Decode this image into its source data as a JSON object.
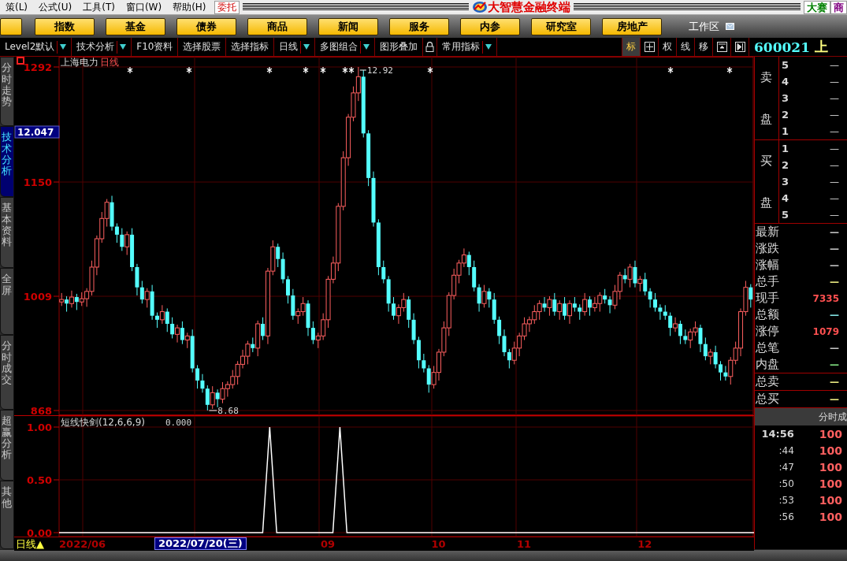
{
  "menu": {
    "items": [
      "策(L)",
      "公式(U)",
      "工具(T)",
      "窗口(W)",
      "帮助(H)"
    ],
    "trade_button": "委托",
    "app_title": "大智慧金融终端",
    "right_buttons": [
      {
        "label": "大赛",
        "color": "#008000"
      },
      {
        "label": "商",
        "color": "#800080"
      }
    ]
  },
  "nav": {
    "buttons": [
      "指数",
      "基金",
      "债券",
      "商品",
      "新闻",
      "服务",
      "内参",
      "研究室",
      "房地产"
    ],
    "workspace": "工作区"
  },
  "toolbar": {
    "items": [
      {
        "kind": "text",
        "label": "Level2默认",
        "dropdown": true
      },
      {
        "kind": "text",
        "label": "技术分析",
        "dropdown": true
      },
      {
        "kind": "text",
        "label": "F10资料",
        "dropdown": false
      },
      {
        "kind": "text",
        "label": "选择股票",
        "dropdown": false
      },
      {
        "kind": "text",
        "label": "选择指标",
        "dropdown": false
      },
      {
        "kind": "text",
        "label": "日线",
        "dropdown": true
      },
      {
        "kind": "text",
        "label": "多图组合",
        "dropdown": true
      },
      {
        "kind": "text",
        "label": "图形叠加",
        "dropdown": false
      },
      {
        "kind": "lock"
      },
      {
        "kind": "text",
        "label": "常用指标",
        "dropdown": true
      }
    ],
    "tools": [
      {
        "kind": "text",
        "label": "标",
        "selected": true
      },
      {
        "kind": "grid",
        "selected": false
      },
      {
        "kind": "text",
        "label": "权",
        "selected": false
      },
      {
        "kind": "text",
        "label": "线",
        "selected": false
      },
      {
        "kind": "text",
        "label": "移",
        "selected": false
      },
      {
        "kind": "window",
        "selected": false
      },
      {
        "kind": "next",
        "selected": false
      }
    ]
  },
  "stock": {
    "code": "600021",
    "name": "上"
  },
  "side_tabs": [
    {
      "label": "分时走势",
      "selected": false
    },
    {
      "label": "技术分析",
      "selected": true
    },
    {
      "label": "基本资料",
      "selected": false
    },
    {
      "label": "全屏",
      "selected": false
    },
    {
      "label": "分时成交",
      "selected": false
    },
    {
      "label": "超赢分析",
      "selected": false
    },
    {
      "label": "其他",
      "selected": false
    }
  ],
  "chart": {
    "title": "上海电力",
    "period": "日线",
    "cursor_value": "12.047",
    "high_label": "12.92",
    "low_label": "8.68",
    "chart_data": {
      "type": "candlestick",
      "grid": true,
      "ylim": [
        868,
        1292
      ],
      "yticks": [
        {
          "value": 1292,
          "label": "1292"
        },
        {
          "value": 1150,
          "label": "1150"
        },
        {
          "value": 1009,
          "label": "1009"
        },
        {
          "value": 868,
          "label": "868"
        }
      ],
      "categories": [
        null,
        null,
        null,
        null,
        null,
        null,
        null,
        null,
        null,
        null,
        null,
        null,
        null,
        null,
        null,
        null,
        null,
        null,
        null,
        null,
        null,
        null,
        null,
        null,
        null,
        null,
        null,
        null,
        null,
        null,
        null,
        null,
        null,
        null,
        null,
        null,
        null,
        null,
        null,
        null,
        null,
        null,
        null,
        null,
        null,
        null,
        null,
        null,
        null,
        null,
        null,
        null,
        null,
        null,
        null,
        null,
        null,
        null,
        null,
        null,
        null,
        null,
        null,
        null,
        null,
        null,
        null,
        null,
        null,
        null,
        null,
        null,
        null,
        null,
        null,
        null,
        null,
        null,
        null,
        null,
        null,
        null,
        null,
        null,
        null,
        null,
        null,
        null,
        null,
        null,
        null,
        null,
        null,
        null,
        null,
        null,
        null,
        null,
        null,
        null,
        null,
        null,
        null,
        null,
        null,
        null,
        null,
        null,
        null,
        null,
        null,
        null,
        null,
        null,
        null,
        null,
        null,
        null,
        null,
        null,
        null,
        null,
        null,
        null,
        null,
        null,
        null,
        null,
        null,
        null,
        null,
        null,
        null,
        null,
        null,
        null,
        null,
        null
      ],
      "ohlc": [
        [
          1002,
          1013,
          997,
          1005
        ],
        [
          1005,
          1009,
          990,
          1000
        ],
        [
          1000,
          1016,
          995,
          1008
        ],
        [
          1008,
          1012,
          992,
          1002
        ],
        [
          1002,
          1014,
          997,
          1006
        ],
        [
          1006,
          1019,
          996,
          1015
        ],
        [
          1015,
          1053,
          1010,
          1045
        ],
        [
          1045,
          1084,
          1035,
          1080
        ],
        [
          1080,
          1113,
          1075,
          1105
        ],
        [
          1105,
          1129,
          1095,
          1125
        ],
        [
          1125,
          1133,
          1090,
          1095
        ],
        [
          1095,
          1099,
          1075,
          1085
        ],
        [
          1085,
          1093,
          1065,
          1070
        ],
        [
          1070,
          1089,
          1060,
          1085
        ],
        [
          1085,
          1093,
          1040,
          1045
        ],
        [
          1045,
          1049,
          1010,
          1020
        ],
        [
          1020,
          1028,
          1000,
          1005
        ],
        [
          1005,
          1019,
          995,
          1015
        ],
        [
          1015,
          1023,
          980,
          985
        ],
        [
          985,
          989,
          970,
          980
        ],
        [
          980,
          998,
          975,
          990
        ],
        [
          990,
          994,
          965,
          975
        ],
        [
          975,
          983,
          957,
          962
        ],
        [
          962,
          974,
          952,
          970
        ],
        [
          970,
          978,
          950,
          955
        ],
        [
          955,
          964,
          945,
          960
        ],
        [
          960,
          968,
          915,
          920
        ],
        [
          920,
          924,
          895,
          905
        ],
        [
          905,
          913,
          890,
          895
        ],
        [
          895,
          899,
          868,
          875
        ],
        [
          875,
          898,
          870,
          890
        ],
        [
          890,
          894,
          872,
          882
        ],
        [
          882,
          903,
          877,
          895
        ],
        [
          895,
          904,
          885,
          900
        ],
        [
          900,
          918,
          895,
          910
        ],
        [
          910,
          929,
          900,
          925
        ],
        [
          925,
          943,
          920,
          935
        ],
        [
          935,
          954,
          925,
          950
        ],
        [
          950,
          958,
          940,
          945
        ],
        [
          945,
          979,
          935,
          975
        ],
        [
          975,
          983,
          955,
          960
        ],
        [
          960,
          1044,
          950,
          1040
        ],
        [
          1040,
          1078,
          1035,
          1070
        ],
        [
          1070,
          1074,
          1045,
          1055
        ],
        [
          1055,
          1063,
          1025,
          1030
        ],
        [
          1030,
          1034,
          1000,
          1010
        ],
        [
          1010,
          1018,
          980,
          985
        ],
        [
          985,
          994,
          975,
          990
        ],
        [
          990,
          1008,
          985,
          1000
        ],
        [
          1000,
          1004,
          960,
          970
        ],
        [
          970,
          978,
          950,
          955
        ],
        [
          955,
          964,
          945,
          960
        ],
        [
          960,
          988,
          955,
          980
        ],
        [
          980,
          1034,
          970,
          1030
        ],
        [
          1030,
          1058,
          1025,
          1050
        ],
        [
          1050,
          1124,
          1040,
          1120
        ],
        [
          1120,
          1188,
          1115,
          1180
        ],
        [
          1180,
          1234,
          1170,
          1230
        ],
        [
          1230,
          1268,
          1225,
          1260
        ],
        [
          1260,
          1292,
          1250,
          1280
        ],
        [
          1280,
          1288,
          1205,
          1210
        ],
        [
          1210,
          1214,
          1145,
          1155
        ],
        [
          1155,
          1163,
          1095,
          1100
        ],
        [
          1100,
          1104,
          1035,
          1045
        ],
        [
          1045,
          1053,
          1025,
          1030
        ],
        [
          1030,
          1034,
          990,
          1000
        ],
        [
          1000,
          1008,
          980,
          985
        ],
        [
          985,
          999,
          975,
          995
        ],
        [
          995,
          1013,
          990,
          1005
        ],
        [
          1005,
          1009,
          970,
          980
        ],
        [
          980,
          988,
          950,
          955
        ],
        [
          955,
          959,
          920,
          930
        ],
        [
          930,
          938,
          915,
          920
        ],
        [
          920,
          924,
          890,
          900
        ],
        [
          900,
          923,
          895,
          915
        ],
        [
          915,
          944,
          905,
          940
        ],
        [
          940,
          978,
          935,
          970
        ],
        [
          970,
          1014,
          960,
          1010
        ],
        [
          1010,
          1043,
          1005,
          1035
        ],
        [
          1035,
          1054,
          1025,
          1050
        ],
        [
          1050,
          1068,
          1045,
          1060
        ],
        [
          1060,
          1064,
          1035,
          1045
        ],
        [
          1045,
          1053,
          1015,
          1020
        ],
        [
          1020,
          1024,
          990,
          1000
        ],
        [
          1000,
          1023,
          995,
          1015
        ],
        [
          1015,
          1019,
          995,
          1005
        ],
        [
          1005,
          1013,
          975,
          980
        ],
        [
          980,
          984,
          950,
          960
        ],
        [
          960,
          968,
          935,
          940
        ],
        [
          940,
          944,
          920,
          930
        ],
        [
          930,
          953,
          925,
          945
        ],
        [
          945,
          964,
          935,
          960
        ],
        [
          960,
          983,
          955,
          975
        ],
        [
          975,
          984,
          965,
          980
        ],
        [
          980,
          998,
          975,
          990
        ],
        [
          990,
          1004,
          980,
          1000
        ],
        [
          1000,
          1008,
          990,
          995
        ],
        [
          995,
          1009,
          985,
          1005
        ],
        [
          1005,
          1013,
          985,
          990
        ],
        [
          990,
          1004,
          980,
          1000
        ],
        [
          1000,
          1008,
          980,
          985
        ],
        [
          985,
          1004,
          975,
          1000
        ],
        [
          1000,
          1008,
          990,
          995
        ],
        [
          995,
          999,
          980,
          990
        ],
        [
          990,
          1013,
          985,
          1005
        ],
        [
          1005,
          1009,
          985,
          995
        ],
        [
          995,
          1008,
          990,
          1000
        ],
        [
          1000,
          1014,
          990,
          1010
        ],
        [
          1010,
          1018,
          1000,
          1005
        ],
        [
          1005,
          1009,
          988,
          998
        ],
        [
          998,
          1023,
          993,
          1015
        ],
        [
          1015,
          1039,
          1005,
          1035
        ],
        [
          1035,
          1043,
          1025,
          1030
        ],
        [
          1030,
          1049,
          1020,
          1045
        ],
        [
          1045,
          1053,
          1020,
          1025
        ],
        [
          1025,
          1034,
          1015,
          1030
        ],
        [
          1030,
          1038,
          1010,
          1015
        ],
        [
          1015,
          1019,
          995,
          1005
        ],
        [
          1005,
          1013,
          990,
          995
        ],
        [
          995,
          999,
          980,
          990
        ],
        [
          990,
          998,
          980,
          985
        ],
        [
          985,
          989,
          960,
          970
        ],
        [
          970,
          983,
          965,
          975
        ],
        [
          975,
          979,
          950,
          960
        ],
        [
          960,
          968,
          950,
          955
        ],
        [
          955,
          969,
          945,
          965
        ],
        [
          965,
          978,
          960,
          970
        ],
        [
          970,
          974,
          940,
          950
        ],
        [
          950,
          958,
          930,
          935
        ],
        [
          935,
          944,
          925,
          940
        ],
        [
          940,
          948,
          920,
          925
        ],
        [
          925,
          929,
          905,
          915
        ],
        [
          915,
          923,
          905,
          910
        ],
        [
          910,
          934,
          900,
          930
        ],
        [
          930,
          953,
          925,
          945
        ],
        [
          945,
          994,
          935,
          990
        ],
        [
          990,
          1028,
          985,
          1020
        ],
        [
          1020,
          1024,
          995,
          1005
        ]
      ]
    }
  },
  "indicator": {
    "title": "短线快剑(12,6,6,9)",
    "value": "0.000",
    "chart_data": {
      "type": "line",
      "grid": true,
      "ylim": [
        0,
        1
      ],
      "yticks": [
        {
          "value": 0,
          "label": "0.00"
        },
        {
          "value": 0.5,
          "label": "0.50"
        },
        {
          "value": 1,
          "label": "1.00"
        }
      ],
      "series": [
        {
          "color": "#ffffff",
          "values": [
            0,
            0,
            0,
            0,
            0,
            0,
            0,
            0,
            0,
            0,
            0,
            0,
            0,
            0,
            0,
            0,
            0,
            0,
            0,
            0,
            0,
            0,
            0,
            0,
            0,
            0,
            0,
            0,
            0,
            0,
            1,
            0,
            0,
            0,
            0,
            0,
            0,
            0,
            0,
            0,
            1,
            0,
            0,
            0,
            0,
            0,
            0,
            0,
            0,
            0,
            0,
            0,
            0,
            0,
            0,
            0,
            0,
            0,
            0,
            0,
            0,
            0,
            0,
            0,
            0,
            0,
            0,
            0,
            0,
            0,
            0,
            0,
            0,
            0,
            0,
            0,
            0,
            0,
            0,
            0,
            0,
            0,
            0,
            0,
            0,
            0,
            0,
            0,
            0,
            0,
            0,
            0,
            0,
            0,
            0,
            0,
            0,
            0,
            0,
            0
          ]
        }
      ]
    }
  },
  "date_bar": {
    "period": "日线▲",
    "labels": [
      "2022/06",
      "09",
      "10",
      "11",
      "12"
    ],
    "cursor_date": "2022/07/20(三)"
  },
  "order_book": {
    "sell_label": [
      "卖",
      "盘"
    ],
    "sell": [
      {
        "rank": "5",
        "price": "—"
      },
      {
        "rank": "4",
        "price": "—"
      },
      {
        "rank": "3",
        "price": "—"
      },
      {
        "rank": "2",
        "price": "—"
      },
      {
        "rank": "1",
        "price": "—"
      }
    ],
    "buy_label": [
      "买",
      "盘"
    ],
    "buy": [
      {
        "rank": "1",
        "price": "—"
      },
      {
        "rank": "2",
        "price": "—"
      },
      {
        "rank": "3",
        "price": "—"
      },
      {
        "rank": "4",
        "price": "—"
      },
      {
        "rank": "5",
        "price": "—"
      }
    ]
  },
  "stats": [
    {
      "label": "最新",
      "value": "—",
      "color": "#c0c0c0"
    },
    {
      "label": "涨跌",
      "value": "—",
      "color": "#c0c0c0"
    },
    {
      "label": "涨幅",
      "value": "—",
      "color": "#c0c0c0"
    },
    {
      "label": "总手",
      "value": "—",
      "color": "#e8e880"
    },
    {
      "label": "现手",
      "value": "7335",
      "color": "#ff5050"
    },
    {
      "label": "总额",
      "value": "—",
      "color": "#80e0e0"
    },
    {
      "label": "涨停",
      "value": "1079",
      "color": "#ff5050"
    },
    {
      "label": "总笔",
      "value": "—",
      "color": "#c0c0c0"
    },
    {
      "label": "内盘",
      "value": "—",
      "color": "#80e080"
    },
    {
      "label": "总卖",
      "value": "—",
      "color": "#e8e880"
    },
    {
      "label": "总买",
      "value": "—",
      "color": "#e8e880"
    }
  ],
  "ticks": {
    "header": "分时成",
    "rows": [
      {
        "time": "14:56",
        "price": "100"
      },
      {
        "time": ":44",
        "price": "100"
      },
      {
        "time": ":47",
        "price": "100"
      },
      {
        "time": ":50",
        "price": "100"
      },
      {
        "time": ":53",
        "price": "100"
      },
      {
        "time": ":56",
        "price": "100"
      }
    ]
  }
}
